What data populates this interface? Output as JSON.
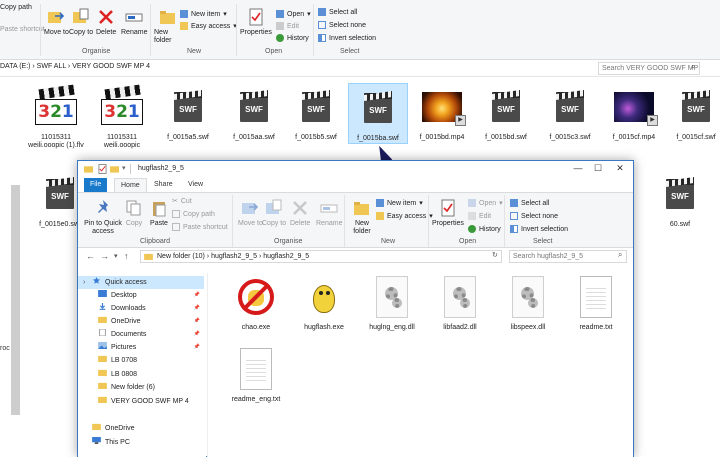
{
  "bg_ribbon": {
    "copy_path": "Copy path",
    "paste_shortcut": "Paste shortcut",
    "move_to": "Move to",
    "copy_to": "Copy to",
    "delete": "Delete",
    "rename": "Rename",
    "new_folder": "New folder",
    "new_item": "New item",
    "easy_access": "Easy access",
    "properties": "Properties",
    "open": "Open",
    "edit": "Edit",
    "history": "History",
    "select_all": "Select all",
    "select_none": "Select none",
    "invert_selection": "Invert selection",
    "group_organise": "Organise",
    "group_new": "New",
    "group_open": "Open",
    "group_select": "Select"
  },
  "bg_address": {
    "path": "DATA (E:)  ›  SWF ALL  ›  VERY GOOD SWF MP 4",
    "search_placeholder": "Search VERY GOOD SWF MP 4"
  },
  "bg_side_fragment": "roc",
  "bg_files": [
    {
      "name": "11015311 weili.ooopic (1).flv",
      "kind": "kmplayer"
    },
    {
      "name": "11015311 weili.ooopic",
      "kind": "kmplayer"
    },
    {
      "name": "f_0015a5.swf",
      "kind": "swf"
    },
    {
      "name": "f_0015aa.swf",
      "kind": "swf"
    },
    {
      "name": "f_0015b5.swf",
      "kind": "swf"
    },
    {
      "name": "f_0015ba.swf",
      "kind": "swf",
      "selected": true
    },
    {
      "name": "f_0015bd.mp4",
      "kind": "video-fire"
    },
    {
      "name": "f_0015bd.swf",
      "kind": "swf"
    },
    {
      "name": "f_0015c3.swf",
      "kind": "swf"
    },
    {
      "name": "f_0015cf.mp4",
      "kind": "video-night"
    },
    {
      "name": "f_0015cf.swf",
      "kind": "swf"
    },
    {
      "name": "f_0015e0.swf",
      "kind": "swf"
    },
    {
      "name": "60.swf",
      "kind": "swf"
    }
  ],
  "window": {
    "title": "hugflash2_9_5",
    "tabs": [
      "File",
      "Home",
      "Share",
      "View"
    ],
    "ribbon": {
      "pin_quick_access": "Pin to Quick access",
      "copy": "Copy",
      "paste": "Paste",
      "cut": "Cut",
      "copy_path": "Copy path",
      "paste_shortcut": "Paste shortcut",
      "move_to": "Move to",
      "copy_to": "Copy to",
      "delete": "Delete",
      "rename": "Rename",
      "new_folder": "New folder",
      "new_item": "New item",
      "easy_access": "Easy access",
      "properties": "Properties",
      "open": "Open",
      "edit": "Edit",
      "history": "History",
      "select_all": "Select all",
      "select_none": "Select none",
      "invert_selection": "Invert selection",
      "group_clipboard": "Clipboard",
      "group_organise": "Organise",
      "group_new": "New",
      "group_open": "Open",
      "group_select": "Select"
    },
    "breadcrumb": "New folder (10)  ›  hugflash2_9_5  ›  hugflash2_9_5",
    "search_placeholder": "Search hugflash2_9_5",
    "nav": [
      {
        "label": "Quick access",
        "kind": "star",
        "selected": true
      },
      {
        "label": "Desktop",
        "kind": "desktop",
        "pinned": true
      },
      {
        "label": "Downloads",
        "kind": "download",
        "pinned": true
      },
      {
        "label": "OneDrive",
        "kind": "folder",
        "pinned": true
      },
      {
        "label": "Documents",
        "kind": "docs",
        "pinned": true
      },
      {
        "label": "Pictures",
        "kind": "pics",
        "pinned": true
      },
      {
        "label": "LB 0708",
        "kind": "folder"
      },
      {
        "label": "LB 0808",
        "kind": "folder"
      },
      {
        "label": "New folder (6)",
        "kind": "folder"
      },
      {
        "label": "VERY GOOD SWF MP 4",
        "kind": "folder"
      },
      {
        "label": "OneDrive",
        "kind": "cloud"
      },
      {
        "label": "This PC",
        "kind": "pc"
      }
    ],
    "files": [
      {
        "name": "chao.exe",
        "kind": "chao"
      },
      {
        "name": "hugflash.exe",
        "kind": "hug"
      },
      {
        "name": "huglng_eng.dll",
        "kind": "dll"
      },
      {
        "name": "libfaad2.dll",
        "kind": "dll"
      },
      {
        "name": "libspeex.dll",
        "kind": "dll"
      },
      {
        "name": "readme.txt",
        "kind": "txt"
      },
      {
        "name": "readme_eng.txt",
        "kind": "txt"
      }
    ]
  },
  "colors": {
    "accent": "#1979ca",
    "selection": "#cce8ff",
    "folder": "#f0c654",
    "ribbon_bg": "#f5f6f7"
  }
}
